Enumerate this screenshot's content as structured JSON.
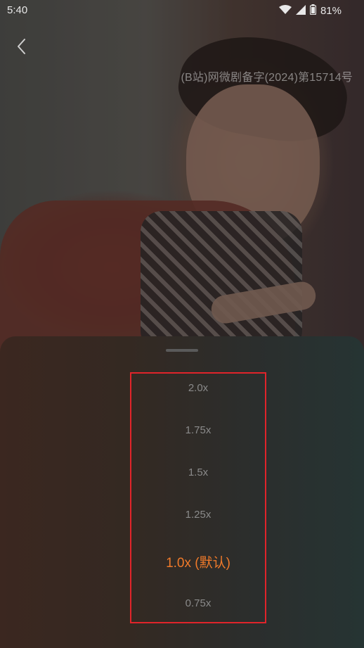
{
  "status_bar": {
    "time": "5:40",
    "battery": "81%"
  },
  "video": {
    "license_text": "(B站)网微剧备字(2024)第15714号"
  },
  "speed_sheet": {
    "options": [
      {
        "label": "2.0x",
        "selected": false
      },
      {
        "label": "1.75x",
        "selected": false
      },
      {
        "label": "1.5x",
        "selected": false
      },
      {
        "label": "1.25x",
        "selected": false
      },
      {
        "label": "1.0x (默认)",
        "selected": true
      },
      {
        "label": "0.75x",
        "selected": false
      }
    ]
  },
  "colors": {
    "selected": "#f07a2a",
    "unselected": "#8a8a8a",
    "highlight_box": "#e0242a"
  }
}
